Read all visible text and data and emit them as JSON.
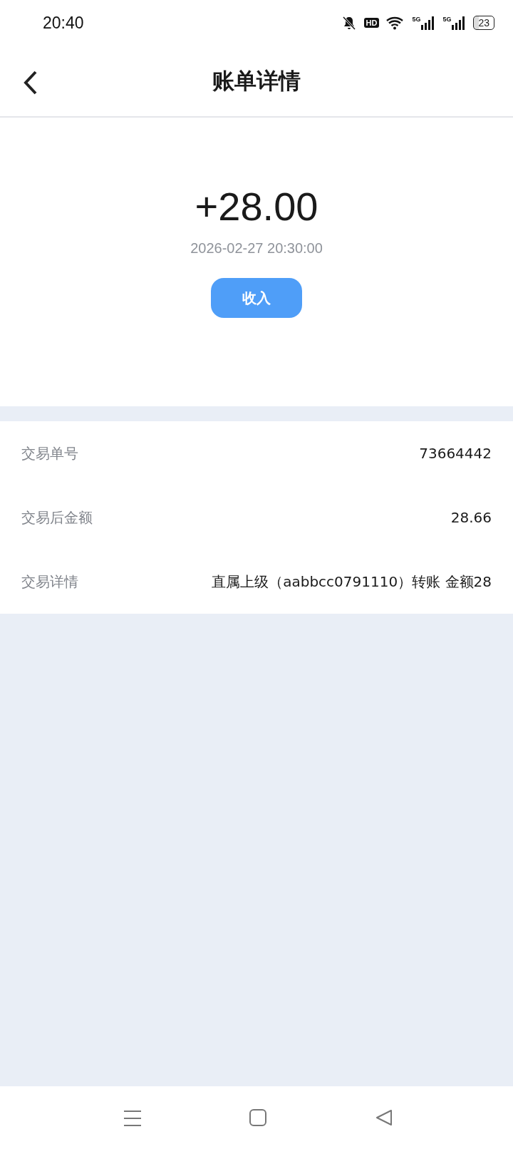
{
  "status_bar": {
    "time": "20:40",
    "hd_label": "HD",
    "signals": [
      {
        "label": "5G"
      },
      {
        "label": "5G"
      }
    ],
    "battery": "23"
  },
  "header": {
    "title": "账单详情"
  },
  "summary": {
    "amount": "+28.00",
    "datetime": "2026-02-27 20:30:00",
    "type_label": "收入"
  },
  "details": [
    {
      "label": "交易单号",
      "value": "73664442"
    },
    {
      "label": "交易后金额",
      "value": "28.66"
    },
    {
      "label": "交易详情",
      "value": "直属上级（aabbcc0791110）转账 金额28"
    }
  ]
}
